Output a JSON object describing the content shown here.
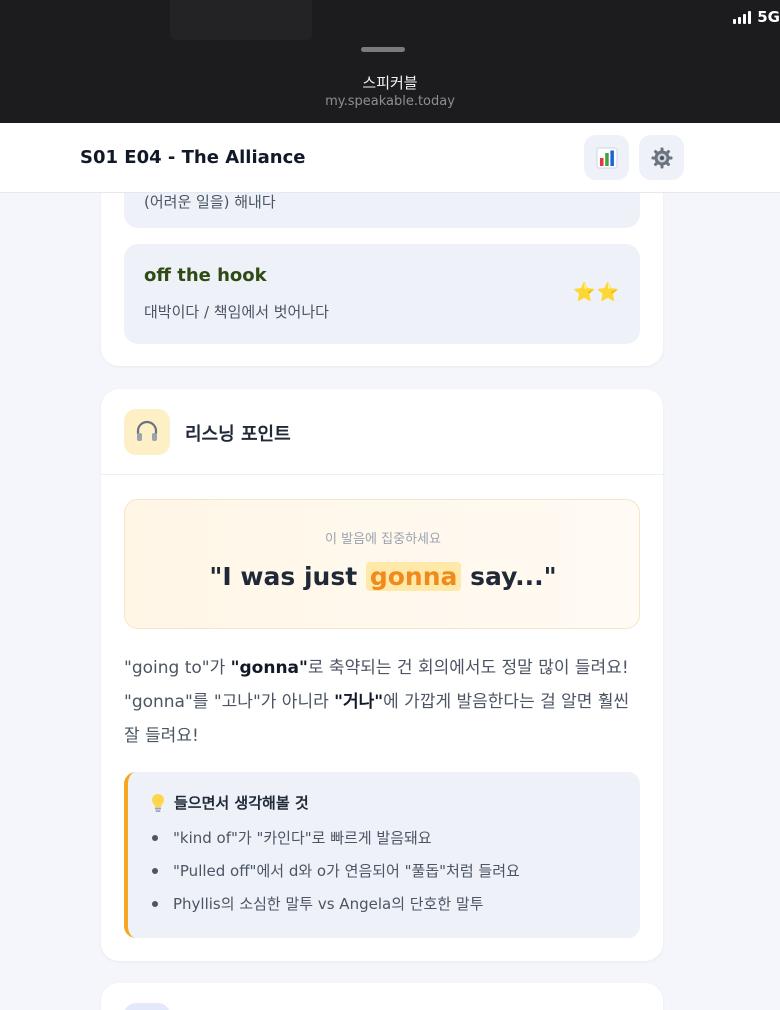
{
  "status": {
    "network": "5G"
  },
  "browser": {
    "site_title": "스피커블",
    "url": "my.speakable.today"
  },
  "header": {
    "episode_title": "S01 E04 - The Alliance"
  },
  "expressions": {
    "partial_meaning": "(어려운 일을) 해내다",
    "items": [
      {
        "phrase": "off the hook",
        "meaning": "대박이다 / 책임에서 벗어나다",
        "stars": "⭐⭐"
      }
    ]
  },
  "listening": {
    "title": "리스닝 포인트",
    "focus_label": "이 발음에 집중하세요",
    "quote_before": "\"I was just ",
    "quote_highlight": "gonna",
    "quote_after": " say...\"",
    "desc": {
      "p1_a": "\"going to\"가 ",
      "p1_b": "\"gonna\"",
      "p1_c": "로 축약되는 건 회의에서도 정말 많이 들려요! \"gonna\"를 \"고나\"가 아니라 ",
      "p1_d": "\"거나\"",
      "p1_e": "에 가깝게 발음한다는 걸 알면 훨씬 잘 들려요!"
    },
    "tips_title": "들으면서 생각해볼 것",
    "tips": [
      "\"kind of\"가 \"카인다\"로 빠르게 발음돼요",
      "\"Pulled off\"에서 d와 o가 연음되어 \"풀돕\"처럼 들려요",
      "Phyllis의 소심한 말투 vs Angela의 단호한 말투"
    ]
  },
  "colors": {
    "accent": "#f5a623",
    "highlight": "#f08a1c",
    "phrase": "#2f4a12"
  }
}
